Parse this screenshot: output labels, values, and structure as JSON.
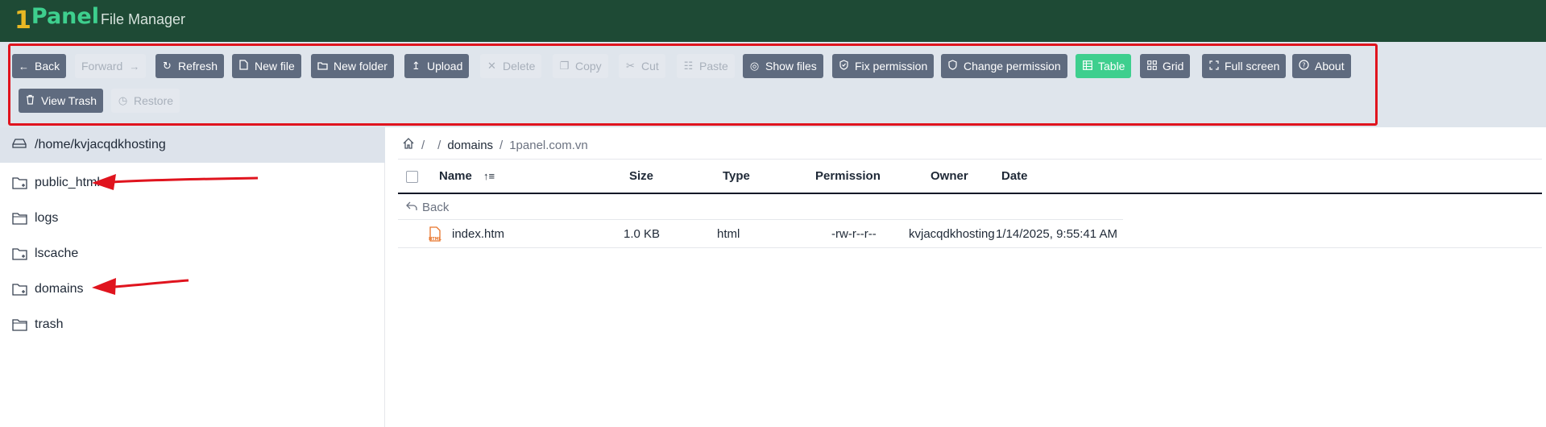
{
  "header": {
    "logo_one": "1",
    "logo_panel": "Panel",
    "app_title": "File Manager",
    "bg_color": "#1e4a35",
    "brand_green": "#3ecf8e",
    "brand_gold": "#e8b824"
  },
  "toolbar": {
    "highlight_color": "#e0141e",
    "buttons": [
      {
        "label": "Back",
        "icon": "arrow-left-icon",
        "state": "enabled"
      },
      {
        "label": "Forward",
        "icon": "arrow-right-icon",
        "state": "disabled"
      },
      {
        "label": "Refresh",
        "icon": "refresh-icon",
        "state": "enabled"
      },
      {
        "label": "New file",
        "icon": "file-icon",
        "state": "enabled"
      },
      {
        "label": "New folder",
        "icon": "folder-icon",
        "state": "enabled"
      },
      {
        "label": "Upload",
        "icon": "upload-icon",
        "state": "enabled"
      },
      {
        "label": "Delete",
        "icon": "close-icon",
        "state": "disabled"
      },
      {
        "label": "Copy",
        "icon": "copy-icon",
        "state": "disabled"
      },
      {
        "label": "Cut",
        "icon": "scissors-icon",
        "state": "disabled"
      },
      {
        "label": "Paste",
        "icon": "clipboard-icon",
        "state": "disabled"
      },
      {
        "label": "Show files",
        "icon": "eye-off-icon",
        "state": "enabled"
      },
      {
        "label": "Fix permission",
        "icon": "shield-check-icon",
        "state": "enabled"
      },
      {
        "label": "Change permission",
        "icon": "shield-icon",
        "state": "enabled"
      },
      {
        "label": "Table",
        "icon": "table-icon",
        "state": "active"
      },
      {
        "label": "Grid",
        "icon": "grid-icon",
        "state": "enabled"
      },
      {
        "label": "Full screen",
        "icon": "fullscreen-icon",
        "state": "enabled"
      },
      {
        "label": "About",
        "icon": "help-circle-icon",
        "state": "enabled"
      },
      {
        "label": "View Trash",
        "icon": "trash-icon",
        "state": "enabled"
      },
      {
        "label": "Restore",
        "icon": "history-icon",
        "state": "disabled"
      }
    ]
  },
  "sidebar": {
    "root_path": "/home/kvjacqdkhosting",
    "root_icon": "drive-icon",
    "items": [
      {
        "label": "public_html",
        "icon": "folder-plus-icon"
      },
      {
        "label": "logs",
        "icon": "folder-icon"
      },
      {
        "label": "lscache",
        "icon": "folder-plus-icon"
      },
      {
        "label": "domains",
        "icon": "folder-plus-icon"
      },
      {
        "label": "trash",
        "icon": "folder-icon"
      }
    ],
    "annotation_arrow_color": "#e0141e"
  },
  "breadcrumb": {
    "home_icon": "home-icon",
    "sep": "/",
    "items": [
      "",
      "domains",
      "1panel.com.vn"
    ]
  },
  "table": {
    "columns": [
      "Name",
      "Size",
      "Type",
      "Permission",
      "Owner",
      "Date"
    ],
    "sort_icon": "sort-ascending-icon",
    "back_label": "Back",
    "rows": [
      {
        "name": "index.htm",
        "size": "1.0 KB",
        "type": "html",
        "permission": "-rw-r--r--",
        "owner": "kvjacqdkhosting",
        "date": "1/14/2025, 9:55:41 AM",
        "icon": "html-file-icon"
      }
    ]
  }
}
